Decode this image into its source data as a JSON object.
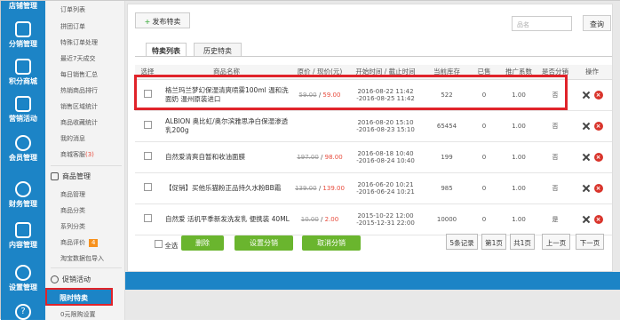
{
  "left_nav": {
    "top_label": "店铺管理",
    "items": [
      {
        "icon": "share-icon",
        "label": "分销管理"
      },
      {
        "icon": "grid-icon",
        "label": "积分商城"
      },
      {
        "icon": "qr-icon",
        "label": "营销活动"
      },
      {
        "icon": "person-icon",
        "label": "会员管理"
      },
      {
        "icon": "yen-icon",
        "label": "财务管理"
      },
      {
        "icon": "monitor-icon",
        "label": "内容管理"
      },
      {
        "icon": "gear-icon",
        "label": "设置管理"
      },
      {
        "icon": "question-icon",
        "label": "?"
      }
    ]
  },
  "sub_nav": {
    "items_a": [
      "订单列表",
      "拼团订单",
      "特殊订单处理",
      "最近7天成交",
      "每日销售汇总",
      "热销商品排行",
      "销售区域统计",
      "商品收藏统计",
      "我的消息"
    ],
    "shop_service": "商城客服",
    "shop_service_count": "(3)",
    "group_title": "商品管理",
    "items_b": [
      "商品管理",
      "商品分类",
      "系列分类",
      "商品评价"
    ],
    "review_badge": "4",
    "taobao": "淘宝数据包导入",
    "promo_title": "促销活动",
    "active_item": "限时特卖",
    "next_item": "0元限购设置"
  },
  "toolbar": {
    "publish_label": "发布特卖",
    "search_placeholder": "品名",
    "query_label": "查询"
  },
  "tabs": [
    "特卖列表",
    "历史特卖"
  ],
  "table": {
    "headers": [
      "选择",
      "商品名称",
      "原价 / 现价(元)",
      "开始时间 / 截止时间",
      "当前库存",
      "已售",
      "推广系数",
      "是否分销",
      "操作"
    ],
    "rows": [
      {
        "name": "格兰玛兰梦幻保湿清爽喷雾100ml 温和洗面奶 温州原装进口",
        "orig": "59.00",
        "now": "59.00",
        "start": "2016-08-22 11:42",
        "end": "-2016-08-25 11:42",
        "stock": "522",
        "sold": "0",
        "factor": "1.00",
        "dist": "否"
      },
      {
        "name": "ALBION 奥比虹/奥尔滨雅思净白保湿渗透乳200g",
        "orig": "",
        "now": "",
        "start": "2016-08-20 15:10",
        "end": "-2016-08-23 15:10",
        "stock": "65454",
        "sold": "0",
        "factor": "1.00",
        "dist": "否"
      },
      {
        "name": "自然爱清爽自暂和收油面膜",
        "orig": "197.00",
        "now": "98.00",
        "start": "2016-08-18 10:40",
        "end": "-2016-08-24 10:40",
        "stock": "199",
        "sold": "0",
        "factor": "1.00",
        "dist": "否"
      },
      {
        "name": "【促销】买他乐猫粉正品持久水粉BB霜",
        "orig": "139.00",
        "now": "139.00",
        "start": "2016-06-20 10:21",
        "end": "-2016-06-24 10:21",
        "stock": "985",
        "sold": "0",
        "factor": "1.00",
        "dist": "否"
      },
      {
        "name": "自然爱 活机平季新发洗发乳 便携装 40ML",
        "orig": "10.00",
        "now": "2.00",
        "start": "2015-10-22 12:00",
        "end": "-2015-12-31 22:00",
        "stock": "10000",
        "sold": "0",
        "factor": "1.00",
        "dist": "是"
      }
    ]
  },
  "actions": {
    "select_all": "全选",
    "delete": "删除",
    "set_dist": "设置分销",
    "cancel_dist": "取消分销"
  },
  "pager": {
    "records": "5条记录",
    "page_first": "第1页",
    "page_total": "共1页",
    "prev": "上一页",
    "next": "下一页"
  },
  "colors": {
    "brand": "#1c84c6",
    "highlight": "#e0232a",
    "green": "#6ab52e",
    "badge": "#f7911d"
  }
}
